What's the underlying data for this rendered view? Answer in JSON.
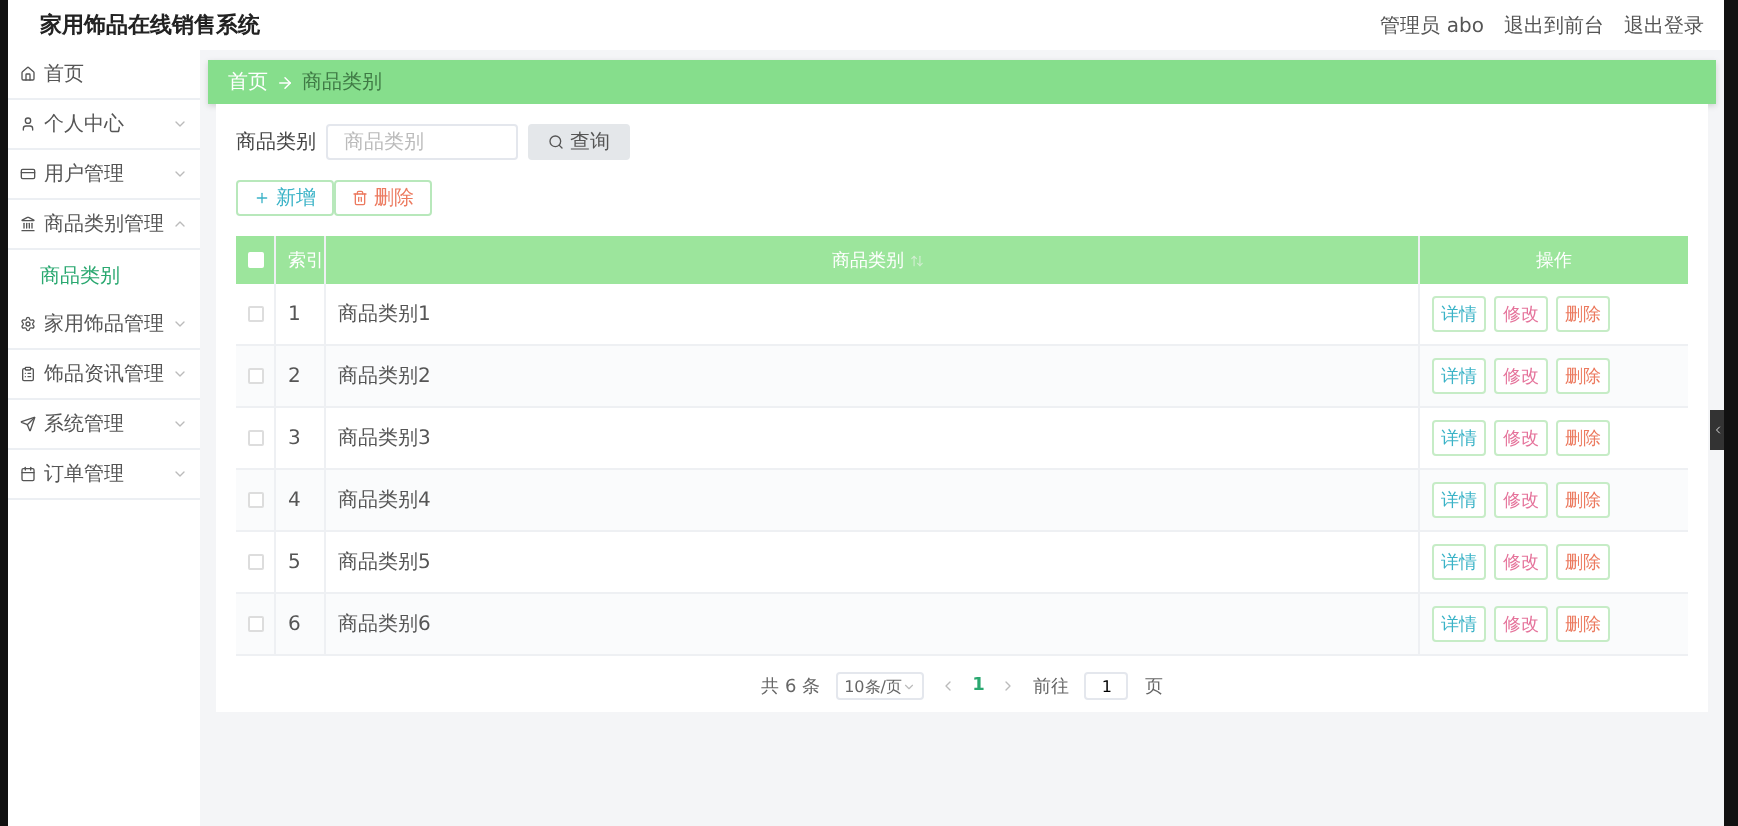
{
  "header": {
    "title": "家用饰品在线销售系统",
    "links": [
      "管理员 abo",
      "退出到前台",
      "退出登录"
    ]
  },
  "sidebar": {
    "items": [
      {
        "label": "首页"
      },
      {
        "label": "个人中心",
        "expanded": false
      },
      {
        "label": "用户管理",
        "expanded": false
      },
      {
        "label": "商品类别管理",
        "expanded": true,
        "children": [
          {
            "label": "商品类别",
            "selected": true
          }
        ]
      },
      {
        "label": "家用饰品管理",
        "expanded": false
      },
      {
        "label": "饰品资讯管理",
        "expanded": false
      },
      {
        "label": "系统管理",
        "expanded": false
      },
      {
        "label": "订单管理",
        "expanded": false
      }
    ]
  },
  "breadcrumb": [
    "首页",
    "商品类别"
  ],
  "search": {
    "label": "商品类别",
    "placeholder": "商品类别",
    "button": "查询"
  },
  "toolbar": [
    {
      "label": "新增",
      "kind": "add"
    },
    {
      "label": "删除",
      "kind": "delete"
    }
  ],
  "table": {
    "all_checked": false,
    "columns": [
      "索引",
      "商品类别",
      "操作"
    ],
    "rows": [
      {
        "checked": false,
        "index": "1",
        "name": "商品类别1",
        "actions": [
          {
            "label": "详情",
            "kind": "detail"
          },
          {
            "label": "修改",
            "kind": "edit"
          },
          {
            "label": "删除",
            "kind": "delete"
          }
        ]
      },
      {
        "checked": false,
        "index": "2",
        "name": "商品类别2",
        "actions": [
          {
            "label": "详情",
            "kind": "detail"
          },
          {
            "label": "修改",
            "kind": "edit"
          },
          {
            "label": "删除",
            "kind": "delete"
          }
        ]
      },
      {
        "checked": false,
        "index": "3",
        "name": "商品类别3",
        "actions": [
          {
            "label": "详情",
            "kind": "detail"
          },
          {
            "label": "修改",
            "kind": "edit"
          },
          {
            "label": "删除",
            "kind": "delete"
          }
        ]
      },
      {
        "checked": false,
        "index": "4",
        "name": "商品类别4",
        "actions": [
          {
            "label": "详情",
            "kind": "detail"
          },
          {
            "label": "修改",
            "kind": "edit"
          },
          {
            "label": "删除",
            "kind": "delete"
          }
        ]
      },
      {
        "checked": false,
        "index": "5",
        "name": "商品类别5",
        "actions": [
          {
            "label": "详情",
            "kind": "detail"
          },
          {
            "label": "修改",
            "kind": "edit"
          },
          {
            "label": "删除",
            "kind": "delete"
          }
        ]
      },
      {
        "checked": false,
        "index": "6",
        "name": "商品类别6",
        "actions": [
          {
            "label": "详情",
            "kind": "detail"
          },
          {
            "label": "修改",
            "kind": "edit"
          },
          {
            "label": "删除",
            "kind": "delete"
          }
        ]
      }
    ]
  },
  "pagination": {
    "total": "共 6 条",
    "page_size": "10条/页",
    "pages": [
      {
        "label": "1",
        "selected": true
      }
    ],
    "goto_label": "前往",
    "goto_value": "1",
    "goto_suffix": "页"
  }
}
